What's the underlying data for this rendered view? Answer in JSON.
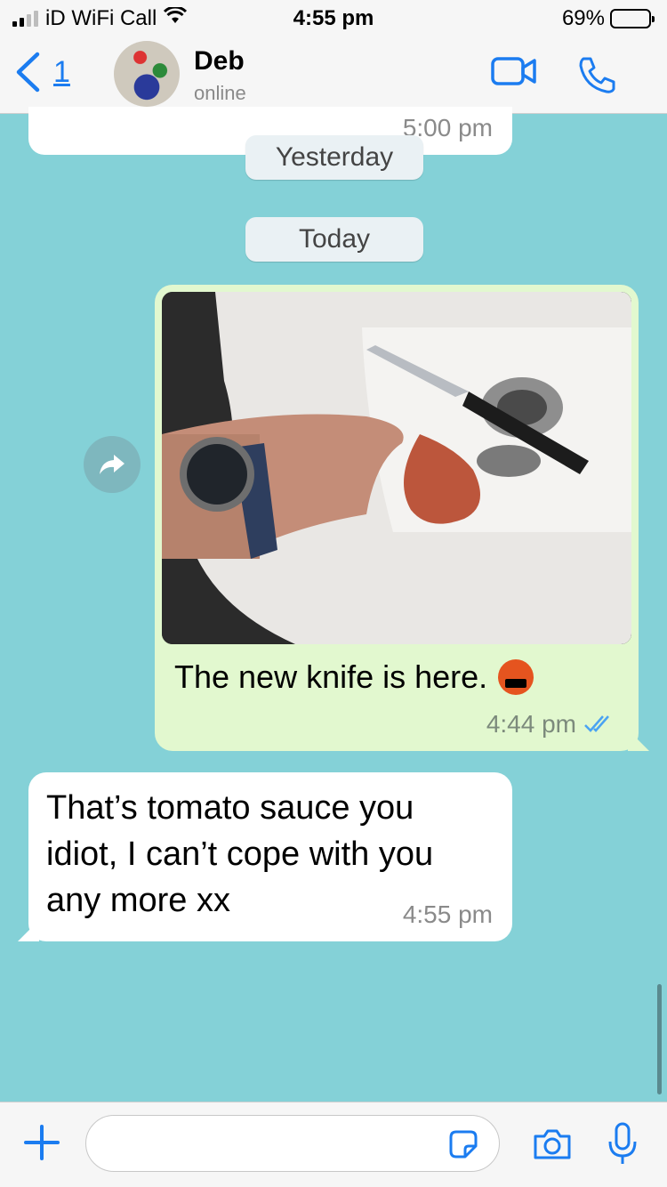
{
  "status_bar": {
    "carrier": "iD WiFi Call",
    "time": "4:55 pm",
    "battery": "69%",
    "battery_level": 0.69
  },
  "header": {
    "back_count": "1",
    "name": "Deb",
    "status": "online"
  },
  "chat": {
    "previous_time": "5:00 pm",
    "date_yesterday": "Yesterday",
    "date_today": "Today",
    "outgoing": {
      "caption": "The new knife is here.",
      "time": "4:44 pm"
    },
    "incoming": {
      "text": "That’s tomato sauce you idiot, I can’t cope with you any more xx",
      "time": "4:55 pm"
    }
  },
  "icons": {
    "signal": "signal-bars-icon",
    "wifi": "wifi-icon",
    "back": "chevron-left-icon",
    "video": "video-camera-icon",
    "call": "phone-icon",
    "forward": "forward-arrow-icon",
    "read": "double-check-icon",
    "add": "plus-icon",
    "sticker": "sticker-icon",
    "camera": "camera-icon",
    "mic": "microphone-icon"
  },
  "colors": {
    "accent": "#1b7cf0",
    "chat_bg": "#84d1d7",
    "outgoing_bubble": "#e2f8cf",
    "incoming_bubble": "#ffffff"
  }
}
